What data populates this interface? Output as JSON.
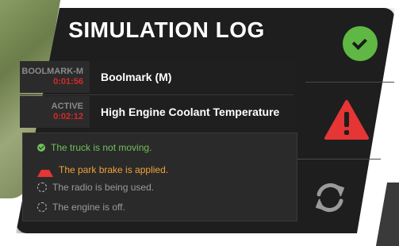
{
  "title": "SIMULATION LOG",
  "log_rows": [
    {
      "tag": "BOOLMARK-M",
      "time": "0:01:56",
      "message": "Boolmark (M)"
    },
    {
      "tag": "ACTIVE",
      "time": "0:02:12",
      "message": "High Engine Coolant Temperature"
    }
  ],
  "status_items": [
    {
      "text": "The truck is not moving.",
      "state": "ok",
      "color": "#6fc05a",
      "icon": "check-circle-icon"
    },
    {
      "text": "The park brake is applied.",
      "state": "warning",
      "color": "#f0a23a",
      "icon": "warning-triangle-icon"
    },
    {
      "text": "The radio is being used.",
      "state": "pending",
      "color": "#9a9a9a",
      "icon": "pending-circle-icon"
    },
    {
      "text": "The engine is off.",
      "state": "pending",
      "color": "#9a9a9a",
      "icon": "pending-circle-icon"
    }
  ],
  "side_buttons": [
    {
      "icon": "check-circle-icon",
      "color": "#5fb844"
    },
    {
      "icon": "warning-triangle-icon",
      "color": "#e53535"
    },
    {
      "icon": "refresh-icon",
      "color": "#9a9a9a"
    }
  ]
}
